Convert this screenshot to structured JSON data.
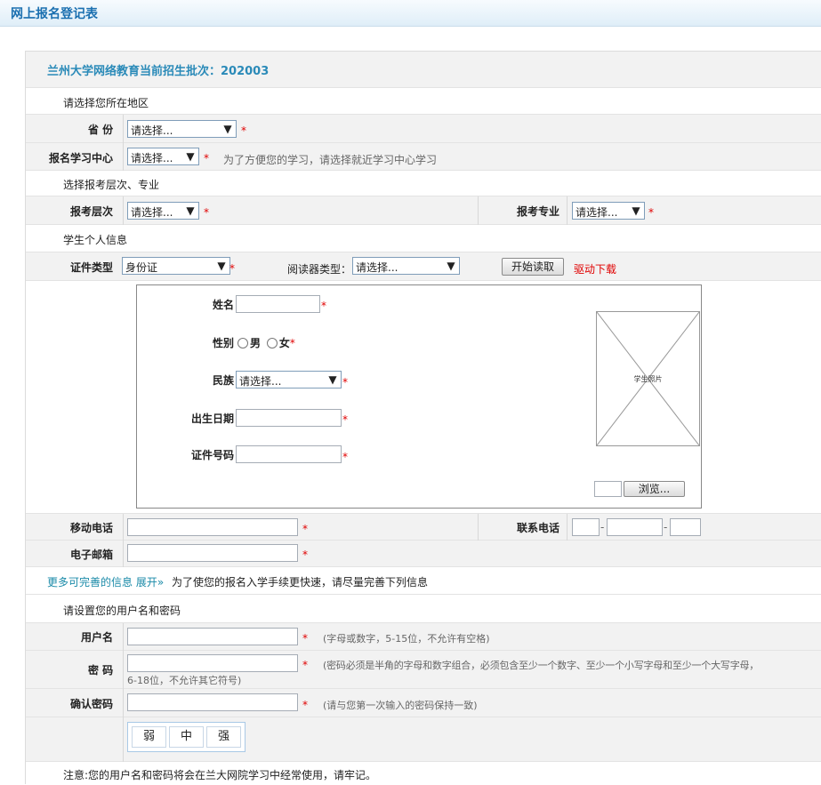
{
  "page_title": "网上报名登记表",
  "header": {
    "batch_title": "兰州大学网络教育当前招生批次：202003"
  },
  "region": {
    "section_label": "请选择您所在地区",
    "province_label": "省 份",
    "province_value": "请选择...",
    "center_label": "报名学习中心",
    "center_value": "请选择...",
    "center_hint": "为了方便您的学习，请选择就近学习中心学习"
  },
  "level": {
    "section_label": "选择报考层次、专业",
    "level_label": "报考层次",
    "level_value": "请选择...",
    "major_label": "报考专业",
    "major_value": "请选择..."
  },
  "personal": {
    "section_label": "学生个人信息",
    "id_type_label": "证件类型",
    "id_type_value": "身份证",
    "reader_type_label": "阅读器类型：",
    "reader_type_value": "请选择...",
    "start_read_button": "开始读取",
    "driver_download_link": "驱动下载",
    "name_label": "姓名",
    "gender_label": "性别",
    "gender_male": "男",
    "gender_female": "女",
    "ethnicity_label": "民族",
    "ethnicity_value": "请选择...",
    "birthdate_label": "出生日期",
    "id_number_label": "证件号码",
    "photo_caption": "学生照片",
    "browse_button": "浏览...",
    "mobile_label": "移动电话",
    "phone_label": "联系电话",
    "email_label": "电子邮箱"
  },
  "more_info": {
    "link_text": "更多可完善的信息 展开»",
    "text": "为了使您的报名入学手续更快速，请尽量完善下列信息"
  },
  "account": {
    "section_label": "请设置您的用户名和密码",
    "username_label": "用户名",
    "username_hint": "(字母或数字，5-15位，不允许有空格)",
    "password_label": "密 码",
    "password_hint_1": "(密码必须是半角的字母和数字组合，必须包含至少一个数字、至少一个小写字母和至少一个大写字母，",
    "password_hint_2": "6-18位，不允许其它符号)",
    "confirm_label": "确认密码",
    "confirm_hint": "(请与您第一次输入的密码保持一致)",
    "strength": [
      "弱",
      "中",
      "强"
    ],
    "note": "注意:您的用户名和密码将会在兰大网院学习中经常使用，请牢记。"
  },
  "required_mark": "*",
  "phone_separator": "-",
  "colors": {
    "accent": "#1a6fb0",
    "required": "#e00000",
    "link": "#1a8aa8"
  }
}
